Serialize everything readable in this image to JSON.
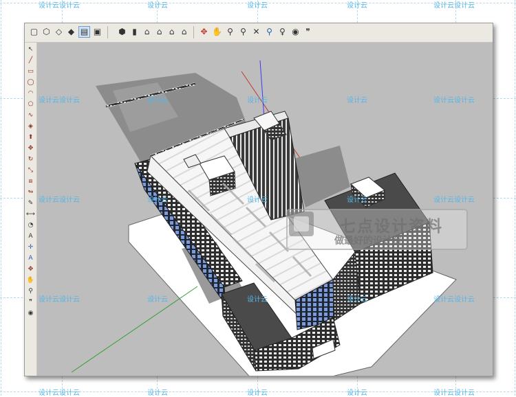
{
  "watermark": {
    "text_double": "设计云设计云",
    "text_single": "设计云"
  },
  "logo": {
    "title": "七点设计资料",
    "subtitle": "做最好的设计资",
    "mark_text": "设计云"
  },
  "toolbar": {
    "buttons": [
      "select-tool",
      "component-tool",
      "eraser-tool",
      "paint-bucket-tool",
      "make-component-tool",
      "section-tool",
      "iso-view",
      "top-view",
      "front-view",
      "right-view",
      "back-view",
      "left-view",
      "orbit-tool",
      "pan-tool",
      "zoom-tool",
      "zoom-window-tool",
      "zoom-extents-tool",
      "previous-view",
      "position-camera",
      "look-around",
      "walk-tool"
    ],
    "active": "make-component-tool"
  },
  "palette": {
    "tools": [
      "select",
      "line",
      "rectangle",
      "circle",
      "arc",
      "polygon",
      "freehand",
      "eraser",
      "push-pull",
      "move",
      "rotate",
      "scale",
      "offset",
      "follow-me",
      "tape-measure",
      "dimension",
      "protractor",
      "text",
      "axes",
      "3d-text",
      "orbit",
      "pan",
      "zoom",
      "walk",
      "look-around"
    ]
  },
  "colors": {
    "viewport_bg": "#bdbdbd",
    "toolbar_bg": "#ece9e2",
    "watermark": "#55b6e8",
    "glass": "#6a8ec9",
    "roof": "#f4f4f4",
    "dark_roof": "#4a4a4a",
    "ground": "#ffffff",
    "shadow": "#8c8c8c"
  }
}
